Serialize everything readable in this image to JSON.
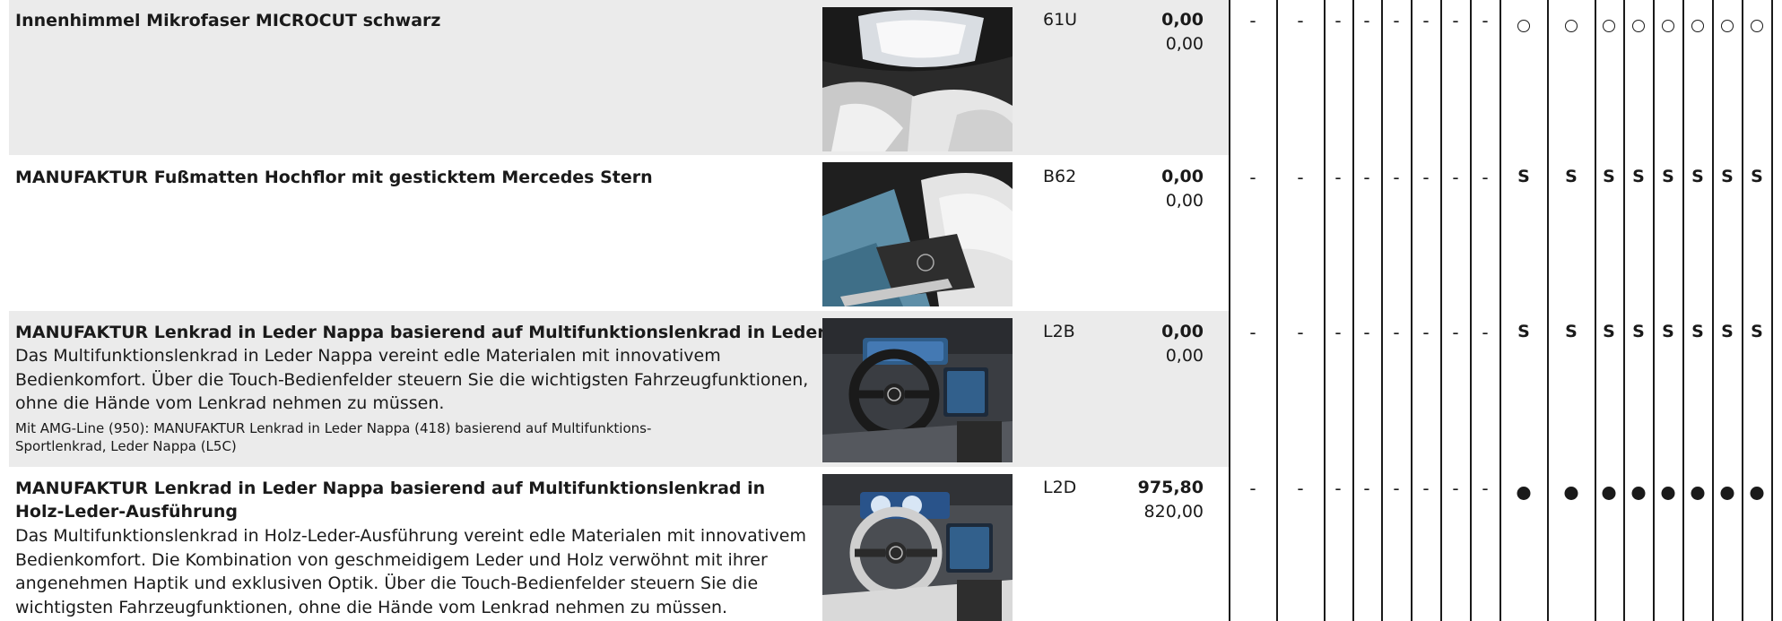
{
  "rows": [
    {
      "title": "Innenhimmel Mikrofaser MICROCUT schwarz",
      "code": "61U",
      "price_gross": "0,00",
      "price_net": "0,00",
      "image_label": "interior-headliner-photo",
      "marks": [
        "-",
        "-",
        "-",
        "-",
        "-",
        "-",
        "-",
        "-",
        "circle",
        "circle",
        "circle",
        "circle",
        "circle",
        "circle",
        "circle",
        "circle"
      ]
    },
    {
      "title": "MANUFAKTUR Fußmatten Hochflor mit gesticktem Mercedes Stern",
      "code": "B62",
      "price_gross": "0,00",
      "price_net": "0,00",
      "image_label": "floor-mats-photo",
      "marks": [
        "-",
        "-",
        "-",
        "-",
        "-",
        "-",
        "-",
        "-",
        "S",
        "S",
        "S",
        "S",
        "S",
        "S",
        "S",
        "S"
      ]
    },
    {
      "title": "MANUFAKTUR Lenkrad in Leder Nappa basierend auf Multifunktionslenkrad in Leder Nappa",
      "description": [
        "Das Multifunktionslenkrad in Leder Nappa vereint edle Materialen mit innovativem",
        "Bedienkomfort. Über die Touch-Bedienfelder steuern Sie die wichtigsten Fahrzeugfunktionen,",
        "ohne die Hände vom Lenkrad nehmen zu müssen."
      ],
      "note": [
        "Mit AMG-Line (950): MANUFAKTUR Lenkrad in Leder Nappa (418) basierend auf Multifunktions-",
        "Sportlenkrad, Leder Nappa (L5C)"
      ],
      "code": "L2B",
      "price_gross": "0,00",
      "price_net": "0,00",
      "image_label": "nappa-steering-wheel-photo",
      "marks": [
        "-",
        "-",
        "-",
        "-",
        "-",
        "-",
        "-",
        "-",
        "S",
        "S",
        "S",
        "S",
        "S",
        "S",
        "S",
        "S"
      ]
    },
    {
      "title_lines": [
        "MANUFAKTUR Lenkrad in Leder Nappa basierend auf Multifunktionslenkrad in",
        "Holz-Leder-Ausführung"
      ],
      "description": [
        "Das Multifunktionslenkrad in Holz-Leder-Ausführung vereint edle Materialen mit innovativem",
        "Bedienkomfort. Die Kombination von geschmeidigem Leder und Holz verwöhnt mit ihrer",
        "angenehmen Haptik und exklusiven Optik. Über die Touch-Bedienfelder steuern Sie die",
        "wichtigsten Fahrzeugfunktionen, ohne die Hände vom Lenkrad nehmen zu müssen."
      ],
      "code": "L2D",
      "price_gross": "975,80",
      "price_net": "820,00",
      "image_label": "wood-leather-steering-wheel-photo",
      "marks": [
        "-",
        "-",
        "-",
        "-",
        "-",
        "-",
        "-",
        "-",
        "dot",
        "dot",
        "dot",
        "dot",
        "dot",
        "dot",
        "dot",
        "dot"
      ]
    }
  ],
  "colors": {
    "row_shade": "#ebebeb",
    "text": "#1a1a1a",
    "grid_line": "#1a1a1a"
  }
}
